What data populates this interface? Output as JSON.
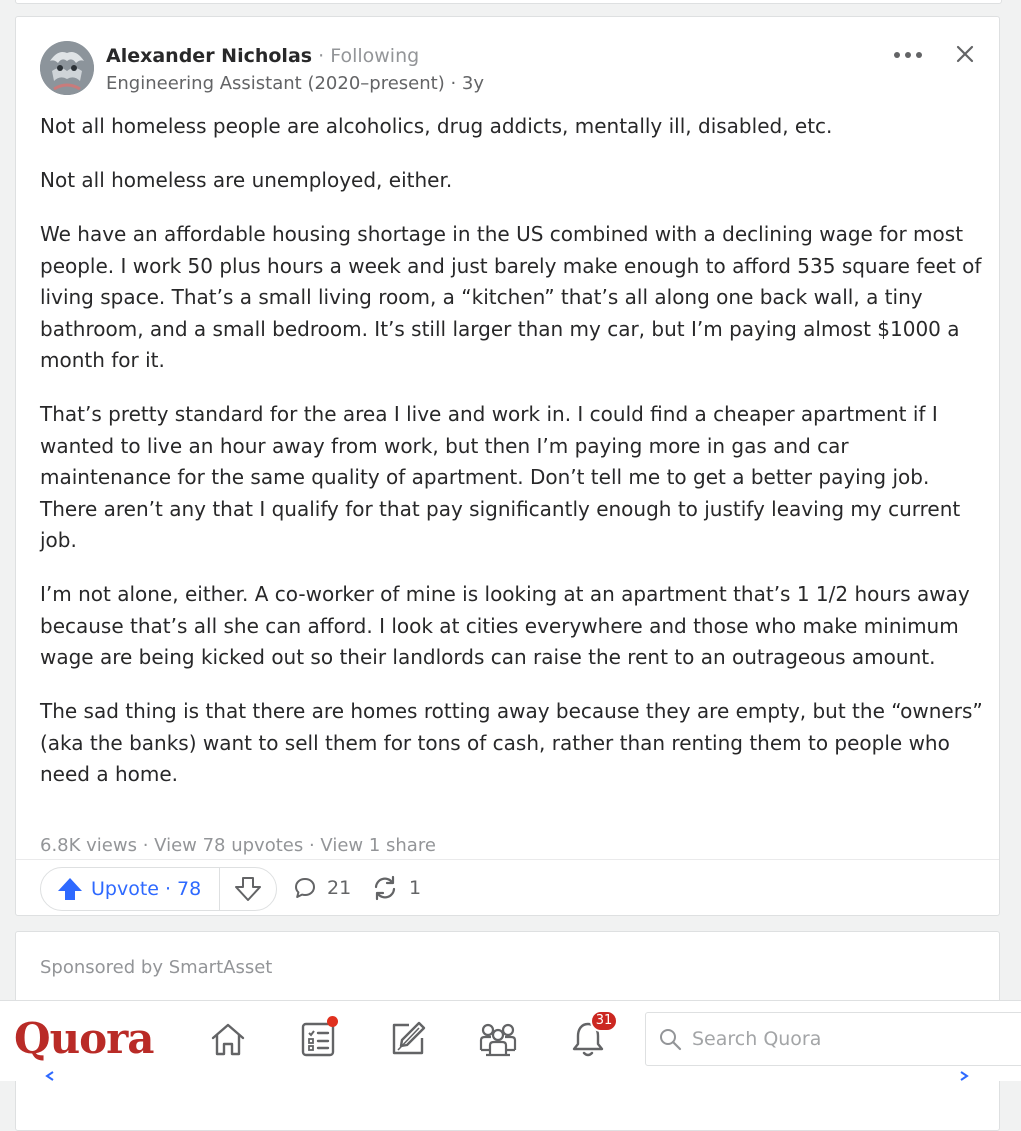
{
  "answer": {
    "author": {
      "name": "Alexander Nicholas",
      "separator": " · ",
      "follow_status": "Following",
      "credential": "Engineering Assistant (2020–present) · 3y"
    },
    "paragraphs": [
      "Not all homeless people are alcoholics, drug addicts, mentally ill, disabled, etc.",
      "Not all homeless are unemployed, either.",
      "We have an affordable housing shortage in the US combined with a declining wage for most people. I work 50 plus hours a week and just barely make enough to afford 535 square feet of living space. That’s a small living room, a “kitchen” that’s all along one back wall, a tiny bathroom, and a small bedroom. It’s still larger than my car, but I’m paying almost $1000 a month for it.",
      "That’s pretty standard for the area I live and work in. I could find a cheaper apartment if I wanted to live an hour away from work, but then I’m paying more in gas and car maintenance for the same quality of apartment. Don’t tell me to get a better paying job. There aren’t any that I qualify for that pay significantly enough to justify leaving my current job.",
      "I’m not alone, either. A co-worker of mine is looking at an apartment that’s 1 1/2 hours away because that’s all she can afford. I look at cities everywhere and those who make minimum wage are being kicked out so their landlords can raise the rent to an outrageous amount.",
      "The sad thing is that there are homes rotting away because they are empty, but the “owners” (aka the banks) want to sell them for tons of cash, rather than renting them to people who need a home."
    ],
    "stats": {
      "views": "6.8K views",
      "sep": " · ",
      "upvotes_link": "View 78 upvotes",
      "shares_link": "View 1 share"
    },
    "actions": {
      "upvote_label": "Upvote",
      "upvote_sep": "·",
      "upvote_count": "78",
      "comment_count": "21",
      "share_count": "1"
    }
  },
  "sponsored": {
    "label": "Sponsored by SmartAsset"
  },
  "nav": {
    "logo": "Quora",
    "notifications_count": "31",
    "search_placeholder": "Search Quora"
  },
  "icons": {
    "avatar": "profile-photo",
    "more": "more-options-icon",
    "close": "close-icon",
    "upvote": "upvote-arrow-icon",
    "downvote": "downvote-arrow-icon",
    "comment": "comment-bubble-icon",
    "share": "share-arrows-icon",
    "home": "home-icon",
    "following": "feed-list-icon",
    "answer": "pencil-square-icon",
    "spaces": "people-group-icon",
    "notifications": "bell-icon",
    "search": "search-icon"
  },
  "colors": {
    "brand": "#b92b27",
    "upvote_blue": "#2e69ff",
    "badge_red": "#cb2721",
    "text": "#282829",
    "muted": "#939598"
  }
}
